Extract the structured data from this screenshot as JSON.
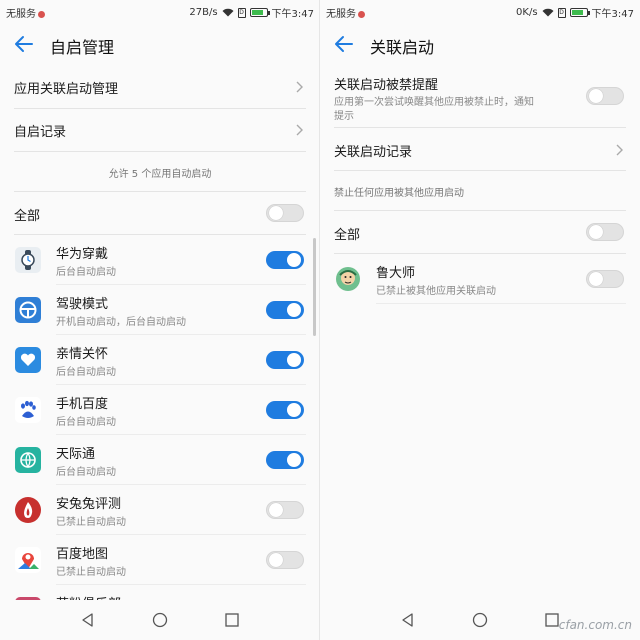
{
  "left": {
    "status": {
      "carrier": "无服务",
      "speed": "27B/s",
      "time": "下午3:47"
    },
    "title": "自启管理",
    "rows": [
      {
        "label": "应用关联启动管理"
      },
      {
        "label": "自启记录"
      }
    ],
    "caption": "允许 5 个应用自动启动",
    "all_label": "全部",
    "apps": [
      {
        "name": "华为穿戴",
        "sub": "后台自动启动",
        "on": true,
        "icon": "watch-icon",
        "color": "#e9eef2"
      },
      {
        "name": "驾驶模式",
        "sub": "开机自动启动，后台自动启动",
        "on": true,
        "icon": "steering-wheel-icon",
        "color": "#2f7fd6"
      },
      {
        "name": "亲情关怀",
        "sub": "后台自动启动",
        "on": true,
        "icon": "heart-hand-icon",
        "color": "#2b8be0"
      },
      {
        "name": "手机百度",
        "sub": "后台自动启动",
        "on": true,
        "icon": "baidu-paw-icon",
        "color": "#ffffff"
      },
      {
        "name": "天际通",
        "sub": "后台自动启动",
        "on": true,
        "icon": "globe-icon",
        "color": "#26b3a0"
      },
      {
        "name": "安兔兔评测",
        "sub": "已禁止自动启动",
        "on": false,
        "icon": "antutu-fire-icon",
        "color": "#c7302e"
      },
      {
        "name": "百度地图",
        "sub": "已禁止自动启动",
        "on": false,
        "icon": "map-pin-icon",
        "color": "#ffffff"
      },
      {
        "name": "花粉俱乐部",
        "sub": "",
        "on": false,
        "icon": "club-icon",
        "color": "#c9486a"
      }
    ]
  },
  "right": {
    "status": {
      "carrier": "无服务",
      "speed": "0K/s",
      "time": "下午3:47"
    },
    "title": "关联启动",
    "reminder": {
      "label": "关联启动被禁提醒",
      "desc_line1": "应用第一次尝试唤醒其他应用被禁止时，通知",
      "desc_line2": "提示",
      "on": false
    },
    "record_label": "关联启动记录",
    "caption": "禁止任何应用被其他应用启动",
    "all_label": "全部",
    "apps": [
      {
        "name": "鲁大师",
        "sub": "已禁止被其他应用关联启动",
        "on": false,
        "icon": "ludashi-icon",
        "color": "#6fbf8e"
      }
    ]
  },
  "watermark": "cfan.com.cn",
  "colors": {
    "accent": "#1f7ce0"
  }
}
